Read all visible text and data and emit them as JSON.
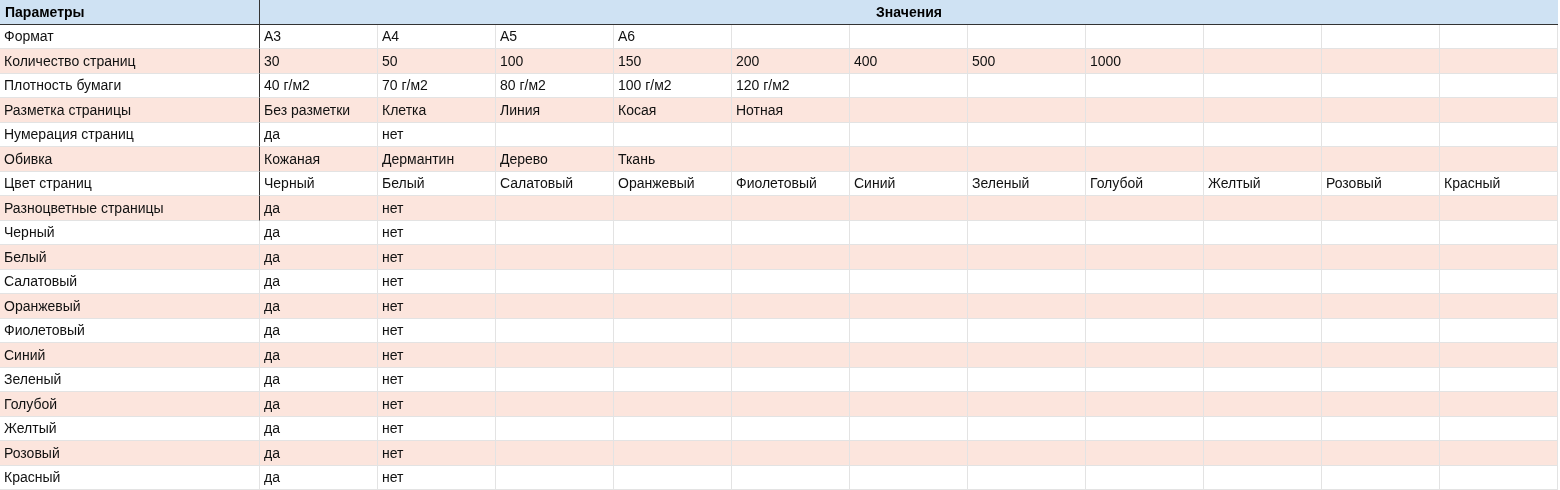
{
  "header": {
    "parameters": "Параметры",
    "values": "Значения"
  },
  "rows": [
    {
      "label": "Формат",
      "values": [
        "A3",
        "A4",
        "A5",
        "A6"
      ]
    },
    {
      "label": "Количество страниц",
      "values": [
        "30",
        "50",
        "100",
        "150",
        "200",
        "400",
        "500",
        "1000"
      ]
    },
    {
      "label": "Плотность бумаги",
      "values": [
        "40 г/м2",
        "70 г/м2",
        "80 г/м2",
        "100 г/м2",
        "120 г/м2"
      ]
    },
    {
      "label": "Разметка страницы",
      "values": [
        "Без разметки",
        "Клетка",
        "Линия",
        "Косая",
        "Нотная"
      ]
    },
    {
      "label": "Нумерация страниц",
      "values": [
        "да",
        "нет"
      ]
    },
    {
      "label": "Обивка",
      "values": [
        "Кожаная",
        "Дермантин",
        "Дерево",
        "Ткань"
      ]
    },
    {
      "label": "Цвет страниц",
      "values": [
        "Черный",
        "Белый",
        "Салатовый",
        "Оранжевый",
        "Фиолетовый",
        "Синий",
        "Зеленый",
        "Голубой",
        "Желтый",
        "Розовый",
        "Красный"
      ]
    },
    {
      "label": "Разноцветные страницы",
      "values": [
        "да",
        "нет"
      ]
    },
    {
      "label": "Черный",
      "values": [
        "да",
        "нет"
      ]
    },
    {
      "label": "Белый",
      "values": [
        "да",
        "нет"
      ]
    },
    {
      "label": "Салатовый",
      "values": [
        "да",
        "нет"
      ]
    },
    {
      "label": "Оранжевый",
      "values": [
        "да",
        "нет"
      ]
    },
    {
      "label": "Фиолетовый",
      "values": [
        "да",
        "нет"
      ]
    },
    {
      "label": "Синий",
      "values": [
        "да",
        "нет"
      ]
    },
    {
      "label": "Зеленый",
      "values": [
        "да",
        "нет"
      ]
    },
    {
      "label": "Голубой",
      "values": [
        "да",
        "нет"
      ]
    },
    {
      "label": "Желтый",
      "values": [
        "да",
        "нет"
      ]
    },
    {
      "label": "Розовый",
      "values": [
        "да",
        "нет"
      ]
    },
    {
      "label": "Красный",
      "values": [
        "да",
        "нет"
      ]
    }
  ]
}
